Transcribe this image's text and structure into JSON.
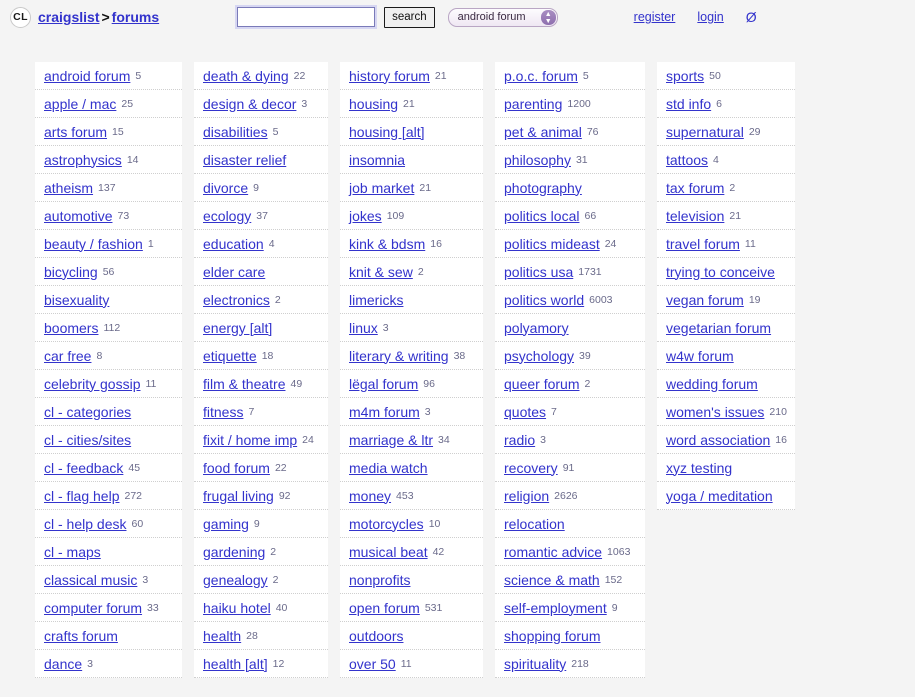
{
  "header": {
    "logo_text": "CL",
    "breadcrumb": {
      "site": "craigslist",
      "separator": ">",
      "section": "forums"
    },
    "search": {
      "value": "",
      "placeholder": "",
      "button_label": "search",
      "selected_forum": "android forum",
      "options": [
        "android forum",
        "apple / mac",
        "arts forum",
        "astrophysics",
        "atheism",
        "automotive"
      ]
    },
    "account": {
      "register_label": "register",
      "login_label": "login",
      "no_entry_glyph": "Ø"
    }
  },
  "colors": {
    "link": "#3333cc",
    "count": "#6a6a8a",
    "page_bg": "#f4f4f4",
    "cell_bg": "#ffffff"
  },
  "forum_columns": [
    {
      "id": "col-1",
      "rows": [
        {
          "name": "android forum",
          "count": "5"
        },
        {
          "name": "apple / mac",
          "count": "25"
        },
        {
          "name": "arts forum",
          "count": "15"
        },
        {
          "name": "astrophysics",
          "count": "14"
        },
        {
          "name": "atheism",
          "count": "137"
        },
        {
          "name": "automotive",
          "count": "73"
        },
        {
          "name": "beauty / fashion",
          "count": "1"
        },
        {
          "name": "bicycling",
          "count": "56"
        },
        {
          "name": "bisexuality",
          "count": ""
        },
        {
          "name": "boomers",
          "count": "112"
        },
        {
          "name": "car free",
          "count": "8"
        },
        {
          "name": "celebrity gossip",
          "count": "11"
        },
        {
          "name": "cl - categories",
          "count": ""
        },
        {
          "name": "cl - cities/sites",
          "count": ""
        },
        {
          "name": "cl - feedback",
          "count": "45"
        },
        {
          "name": "cl - flag help",
          "count": "272"
        },
        {
          "name": "cl - help desk",
          "count": "60"
        },
        {
          "name": "cl - maps",
          "count": ""
        },
        {
          "name": "classical music",
          "count": "3"
        },
        {
          "name": "computer forum",
          "count": "33"
        },
        {
          "name": "crafts forum",
          "count": ""
        },
        {
          "name": "dance",
          "count": "3"
        }
      ]
    },
    {
      "id": "col-2",
      "rows": [
        {
          "name": "death & dying",
          "count": "22"
        },
        {
          "name": "design & decor",
          "count": "3"
        },
        {
          "name": "disabilities",
          "count": "5"
        },
        {
          "name": "disaster relief",
          "count": ""
        },
        {
          "name": "divorce",
          "count": "9"
        },
        {
          "name": "ecology",
          "count": "37"
        },
        {
          "name": "education",
          "count": "4"
        },
        {
          "name": "elder care",
          "count": ""
        },
        {
          "name": "electronics",
          "count": "2"
        },
        {
          "name": "energy [alt]",
          "count": ""
        },
        {
          "name": "etiquette",
          "count": "18"
        },
        {
          "name": "film & theatre",
          "count": "49"
        },
        {
          "name": "fitness",
          "count": "7"
        },
        {
          "name": "fixit / home imp",
          "count": "24"
        },
        {
          "name": "food forum",
          "count": "22"
        },
        {
          "name": "frugal living",
          "count": "92"
        },
        {
          "name": "gaming",
          "count": "9"
        },
        {
          "name": "gardening",
          "count": "2"
        },
        {
          "name": "genealogy",
          "count": "2"
        },
        {
          "name": "haiku hotel",
          "count": "40"
        },
        {
          "name": "health",
          "count": "28"
        },
        {
          "name": "health [alt]",
          "count": "12"
        }
      ]
    },
    {
      "id": "col-3",
      "rows": [
        {
          "name": "history forum",
          "count": "21"
        },
        {
          "name": "housing",
          "count": "21"
        },
        {
          "name": "housing [alt]",
          "count": ""
        },
        {
          "name": "insomnia",
          "count": ""
        },
        {
          "name": "job market",
          "count": "21"
        },
        {
          "name": "jokes",
          "count": "109"
        },
        {
          "name": "kink & bdsm",
          "count": "16"
        },
        {
          "name": "knit & sew",
          "count": "2"
        },
        {
          "name": "limericks",
          "count": ""
        },
        {
          "name": "linux",
          "count": "3"
        },
        {
          "name": "literary & writing",
          "count": "38"
        },
        {
          "name": "lëgal forum",
          "count": "96"
        },
        {
          "name": "m4m forum",
          "count": "3"
        },
        {
          "name": "marriage & ltr",
          "count": "34"
        },
        {
          "name": "media watch",
          "count": ""
        },
        {
          "name": "money",
          "count": "453"
        },
        {
          "name": "motorcycles",
          "count": "10"
        },
        {
          "name": "musical beat",
          "count": "42"
        },
        {
          "name": "nonprofits",
          "count": ""
        },
        {
          "name": "open forum",
          "count": "531"
        },
        {
          "name": "outdoors",
          "count": ""
        },
        {
          "name": "over 50",
          "count": "11"
        }
      ]
    },
    {
      "id": "col-4",
      "rows": [
        {
          "name": "p.o.c. forum",
          "count": "5"
        },
        {
          "name": "parenting",
          "count": "1200"
        },
        {
          "name": "pet & animal",
          "count": "76"
        },
        {
          "name": "philosophy",
          "count": "31"
        },
        {
          "name": "photography",
          "count": ""
        },
        {
          "name": "politics local",
          "count": "66"
        },
        {
          "name": "politics mideast",
          "count": "24"
        },
        {
          "name": "politics usa",
          "count": "1731"
        },
        {
          "name": "politics world",
          "count": "6003"
        },
        {
          "name": "polyamory",
          "count": ""
        },
        {
          "name": "psychology",
          "count": "39"
        },
        {
          "name": "queer forum",
          "count": "2"
        },
        {
          "name": "quotes",
          "count": "7"
        },
        {
          "name": "radio",
          "count": "3"
        },
        {
          "name": "recovery",
          "count": "91"
        },
        {
          "name": "religion",
          "count": "2626"
        },
        {
          "name": "relocation",
          "count": ""
        },
        {
          "name": "romantic advice",
          "count": "1063"
        },
        {
          "name": "science & math",
          "count": "152"
        },
        {
          "name": "self-employment",
          "count": "9"
        },
        {
          "name": "shopping forum",
          "count": ""
        },
        {
          "name": "spirituality",
          "count": "218"
        }
      ]
    },
    {
      "id": "col-5",
      "rows": [
        {
          "name": "sports",
          "count": "50"
        },
        {
          "name": "std info",
          "count": "6"
        },
        {
          "name": "supernatural",
          "count": "29"
        },
        {
          "name": "tattoos",
          "count": "4"
        },
        {
          "name": "tax forum",
          "count": "2"
        },
        {
          "name": "television",
          "count": "21"
        },
        {
          "name": "travel forum",
          "count": "11"
        },
        {
          "name": "trying to conceive",
          "count": ""
        },
        {
          "name": "vegan forum",
          "count": "19"
        },
        {
          "name": "vegetarian forum",
          "count": ""
        },
        {
          "name": "w4w forum",
          "count": ""
        },
        {
          "name": "wedding forum",
          "count": ""
        },
        {
          "name": "women's issues",
          "count": "210"
        },
        {
          "name": "word association",
          "count": "16"
        },
        {
          "name": "xyz testing",
          "count": ""
        },
        {
          "name": "yoga / meditation",
          "count": ""
        }
      ]
    }
  ]
}
